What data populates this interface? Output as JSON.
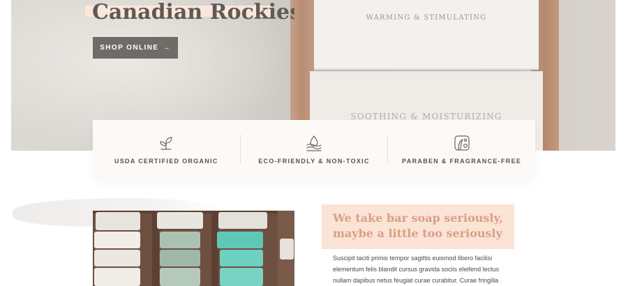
{
  "hero": {
    "title": "Canadian Rockies",
    "cta_label": "SHOP ONLINE",
    "cta_arrow": "→",
    "soap_top_label": "WARMING & STIMULATING",
    "soap_bottom_label": "SOOTHING & MOISTURIZING"
  },
  "features": [
    {
      "icon": "seedling-icon",
      "label": "USDA CERTIFIED ORGANIC"
    },
    {
      "icon": "water-drop-icon",
      "label": "ECO-FRIENDLY & NON-TOXIC"
    },
    {
      "icon": "face-icon",
      "label": "PARABEN & FRAGRANCE-FREE"
    }
  ],
  "about": {
    "heading": "We take bar soap seriously, maybe a little too seriously",
    "body": "Suscipit taciti primis tempor sagittis euismod libero facilisi elementum felis blandit cursus gravida sociis eleifend lectus nullam dapibus netus feugiat curae curabitur. Curae fringilla"
  },
  "colors": {
    "accent_highlight": "#fbe3d6",
    "heading_text": "#d99f86",
    "button_bg": "#716b68"
  }
}
